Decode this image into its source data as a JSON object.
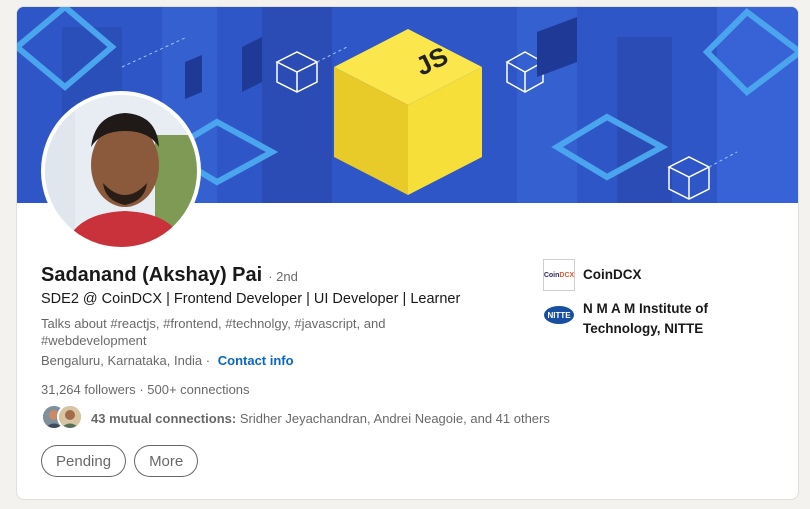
{
  "profile": {
    "name": "Sadanand (Akshay) Pai",
    "degree": "· 2nd",
    "headline": "SDE2 @ CoinDCX | Frontend Developer | UI Developer | Learner",
    "talks_about": "Talks about #reactjs, #frontend, #technolgy, #javascript, and #webdevelopment",
    "location": "Bengaluru, Karnataka, India ·",
    "contact_info": "Contact info",
    "followers_count": "31,264",
    "followers_label": "followers",
    "connections": "· 500+ connections",
    "mutual_strong": "43 mutual connections:",
    "mutual_rest": "Sridher Jeyachandran, Andrei Neagoie, and 41 others"
  },
  "banner": {
    "badge": "JS",
    "icon": "javascript-cube-icon"
  },
  "actions": {
    "pending": "Pending",
    "more": "More"
  },
  "experience": {
    "company": "CoinDCX",
    "company_logo_text": "Coin",
    "company_logo_accent": "DCX",
    "school": "N M A M Institute of Technology, NITTE",
    "school_logo_text": "NITTE"
  },
  "colors": {
    "link": "#0a66c2",
    "banner_blue": "#2f56c7",
    "js_yellow": "#f7df3a"
  }
}
